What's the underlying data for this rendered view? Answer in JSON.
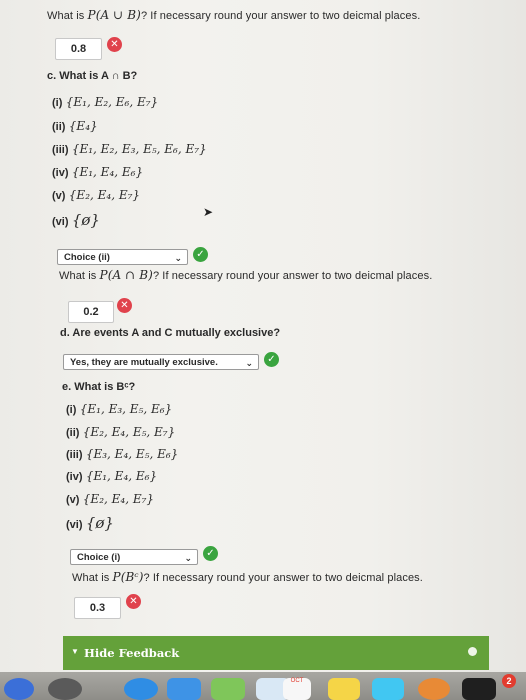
{
  "top_question": {
    "prefix": "What is ",
    "expr": "P(A ∪ B)",
    "suffix": "? If necessary round your answer to two deicmal places.",
    "answer": "0.8",
    "answer_status": "incorrect"
  },
  "part_c": {
    "heading": "c. What is A ∩ B?",
    "options": [
      {
        "label": "(i)",
        "set": "{E₁, E₂, E₆, E₇}"
      },
      {
        "label": "(ii)",
        "set": "{E₄}"
      },
      {
        "label": "(iii)",
        "set": "{E₁, E₂, E₃, E₅, E₆, E₇}"
      },
      {
        "label": "(iv)",
        "set": "{E₁, E₄, E₆}"
      },
      {
        "label": "(v)",
        "set": "{E₂, E₄, E₇}"
      },
      {
        "label": "(vi)",
        "set": "{ø}"
      }
    ],
    "select_value": "Choice (ii)",
    "select_status": "correct",
    "question_prefix": "What is ",
    "question_expr": "P(A ∩ B)",
    "question_suffix": "? If necessary round your answer to two deicmal places.",
    "answer": "0.2",
    "answer_status": "incorrect"
  },
  "part_d": {
    "heading": "d. Are events A and C mutually exclusive?",
    "select_value": "Yes, they are mutually exclusive.",
    "select_status": "correct"
  },
  "part_e": {
    "heading": "e. What is Bᶜ?",
    "options": [
      {
        "label": "(i)",
        "set": "{E₁, E₃, E₅, E₆}"
      },
      {
        "label": "(ii)",
        "set": "{E₂, E₄, E₅, E₇}"
      },
      {
        "label": "(iii)",
        "set": "{E₃, E₄, E₅, E₆}"
      },
      {
        "label": "(iv)",
        "set": "{E₁, E₄, E₆}"
      },
      {
        "label": "(v)",
        "set": "{E₂, E₄, E₇}"
      },
      {
        "label": "(vi)",
        "set": "{ø}"
      }
    ],
    "select_value": "Choice (i)",
    "select_status": "correct",
    "question_prefix": "What is ",
    "question_expr": "P(Bᶜ)",
    "question_suffix": "? If necessary round your answer to two deicmal places.",
    "answer": "0.3",
    "answer_status": "incorrect"
  },
  "feedback": {
    "label": "Hide Feedback"
  },
  "dock": {
    "calendar_month": "OCT",
    "badge_count": "2"
  },
  "icons": {
    "incorrect": "x-circle-icon",
    "correct": "check-circle-icon"
  },
  "colors": {
    "incorrect": "#e0424c",
    "correct": "#3aa43f",
    "feedback_bar": "#64a13a"
  }
}
